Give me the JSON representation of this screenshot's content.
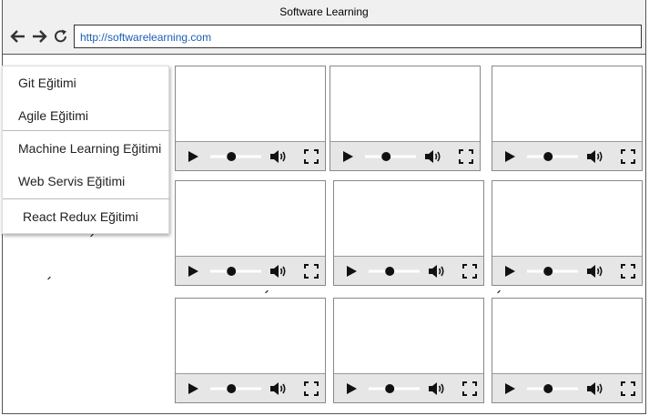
{
  "window": {
    "title": "Software Learning"
  },
  "toolbar": {
    "back_icon": "arrow-left-icon",
    "forward_icon": "arrow-right-icon",
    "reload_icon": "reload-icon",
    "url": "http://softwarelearning.com"
  },
  "menu": {
    "items": [
      {
        "label": "Git Eğitimi"
      },
      {
        "label": "Agile Eğitimi"
      },
      {
        "label": "Machine Learning Eğitimi"
      },
      {
        "label": "Web Servis Eğitimi"
      },
      {
        "label": "React Redux Eğitimi"
      }
    ]
  },
  "players": [
    {
      "seek_fraction": 0.4
    },
    {
      "seek_fraction": 0.4
    },
    {
      "seek_fraction": 0.4
    },
    {
      "seek_fraction": 0.4
    },
    {
      "seek_fraction": 0.4
    },
    {
      "seek_fraction": 0.4
    },
    {
      "seek_fraction": 0.4
    },
    {
      "seek_fraction": 0.4
    },
    {
      "seek_fraction": 0.4
    }
  ],
  "player_controls": {
    "play_icon": "play-icon",
    "volume_icon": "volume-icon",
    "fullscreen_icon": "fullscreen-icon"
  }
}
